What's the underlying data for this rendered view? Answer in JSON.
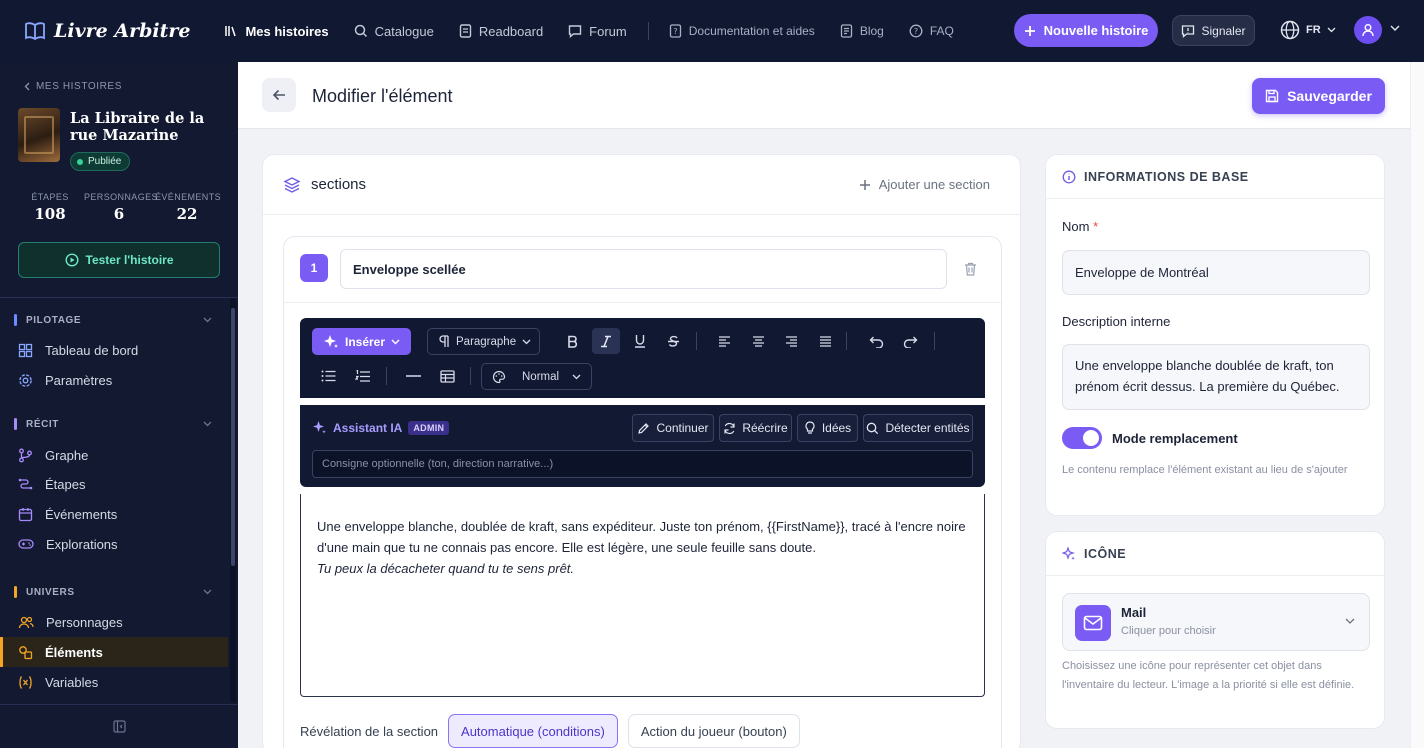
{
  "app": {
    "name": "Livre Arbitre"
  },
  "nav": {
    "items": [
      "Mes histoires",
      "Catalogue",
      "Readboard",
      "Forum"
    ],
    "secondary": [
      "Documentation et aides",
      "Blog",
      "FAQ"
    ],
    "new_story": "Nouvelle histoire",
    "signal": "Signaler",
    "lang": "FR"
  },
  "sidebar": {
    "crumb": "MES HISTOIRES",
    "story_title": "La Libraire de la rue Mazarine",
    "status": "Publiée",
    "stats": [
      {
        "label": "ÉTAPES",
        "value": "108"
      },
      {
        "label": "PERSONNAGES",
        "value": "6"
      },
      {
        "label": "ÉVÉNEMENTS",
        "value": "22"
      }
    ],
    "test_button": "Tester l'histoire",
    "sections": {
      "pilotage": {
        "title": "PILOTAGE",
        "items": [
          "Tableau de bord",
          "Paramètres"
        ]
      },
      "recit": {
        "title": "RÉCIT",
        "items": [
          "Graphe",
          "Étapes",
          "Événements",
          "Explorations"
        ]
      },
      "univers": {
        "title": "UNIVERS",
        "items": [
          "Personnages",
          "Éléments",
          "Variables"
        ]
      }
    }
  },
  "header": {
    "title": "Modifier l'élément",
    "save": "Sauvegarder"
  },
  "sections_card": {
    "title": "sections",
    "add": "Ajouter une section",
    "section": {
      "number": "1",
      "name": "Enveloppe scellée",
      "toolbar": {
        "insert": "Insérer",
        "paragraph": "Paragraphe",
        "style": "Normal"
      },
      "ai": {
        "title": "Assistant IA",
        "badge": "ADMIN",
        "buttons": [
          "Continuer",
          "Réécrire",
          "Idées",
          "Détecter entités"
        ],
        "placeholder": "Consigne optionnelle (ton, direction narrative...)"
      },
      "content": {
        "line1": "Une enveloppe blanche, doublée de kraft, sans expéditeur. Juste ton prénom, {{FirstName}}, tracé à l'encre noire d'une main que tu ne connais pas encore. Elle est légère, une seule feuille sans doute.",
        "line2": "Tu peux la décacheter quand tu te sens prêt."
      },
      "reveal": {
        "label": "Révélation de la section",
        "options": [
          "Automatique (conditions)",
          "Action du joueur (bouton)"
        ],
        "selected": "Automatique (conditions)"
      }
    }
  },
  "basic_info": {
    "title": "INFORMATIONS DE BASE",
    "name_label": "Nom",
    "name_value": "Enveloppe de Montréal",
    "desc_label": "Description interne",
    "desc_value": "Une enveloppe blanche doublée de kraft, ton prénom écrit dessus. La première du Québec.",
    "toggle_label": "Mode remplacement",
    "toggle_on": true,
    "toggle_help": "Le contenu remplace l'élément existant au lieu de s'ajouter"
  },
  "icon_panel": {
    "title": "ICÔNE",
    "icon_name": "Mail",
    "icon_hint": "Cliquer pour choisir",
    "help": "Choisissez une icône pour représenter cet objet dans l'inventaire du lecteur. L'image a la priorité si elle est définie."
  },
  "colors": {
    "accent": "#7a5cf5",
    "nav_bg": "#111831",
    "active_marker": "#f5a524",
    "success": "#34d399"
  }
}
